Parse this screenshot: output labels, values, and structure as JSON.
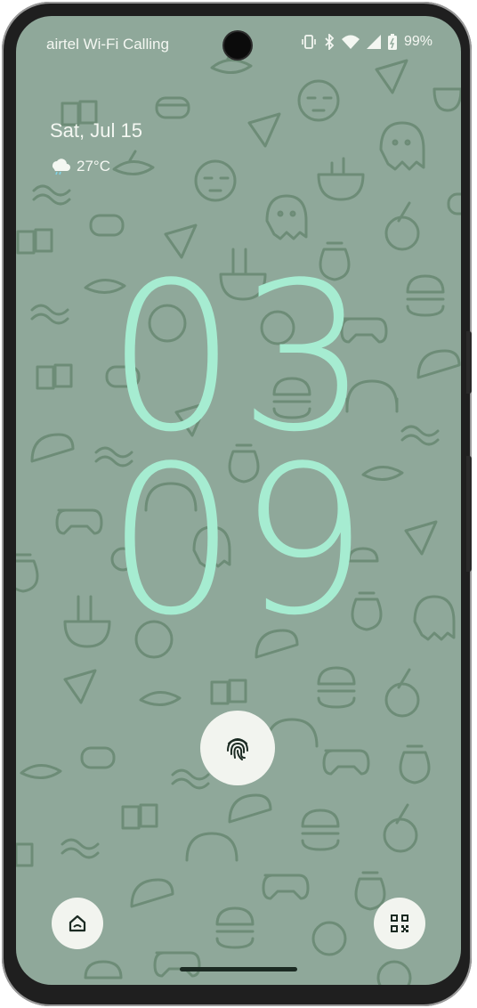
{
  "status_bar": {
    "carrier": "airtel Wi-Fi Calling",
    "battery_percent": "99%",
    "icons": [
      "vibrate-icon",
      "bluetooth-icon",
      "wifi-icon",
      "signal-icon",
      "battery-charging-icon"
    ]
  },
  "lockscreen": {
    "date": "Sat, Jul 15",
    "weather": {
      "icon": "cloudy-icon",
      "temperature": "27°C"
    },
    "clock": {
      "hours": "03",
      "minutes": "09"
    },
    "fingerprint_icon": "fingerprint-icon",
    "left_shortcut_icon": "home-icon",
    "right_shortcut_icon": "qr-code-icon"
  },
  "colors": {
    "wallpaper": "#8fa89a",
    "clock_text": "#a6ecd1",
    "doodles": "#6d8c77",
    "status_text": "#f4f7f2",
    "button_bg": "#f2f4ef"
  }
}
